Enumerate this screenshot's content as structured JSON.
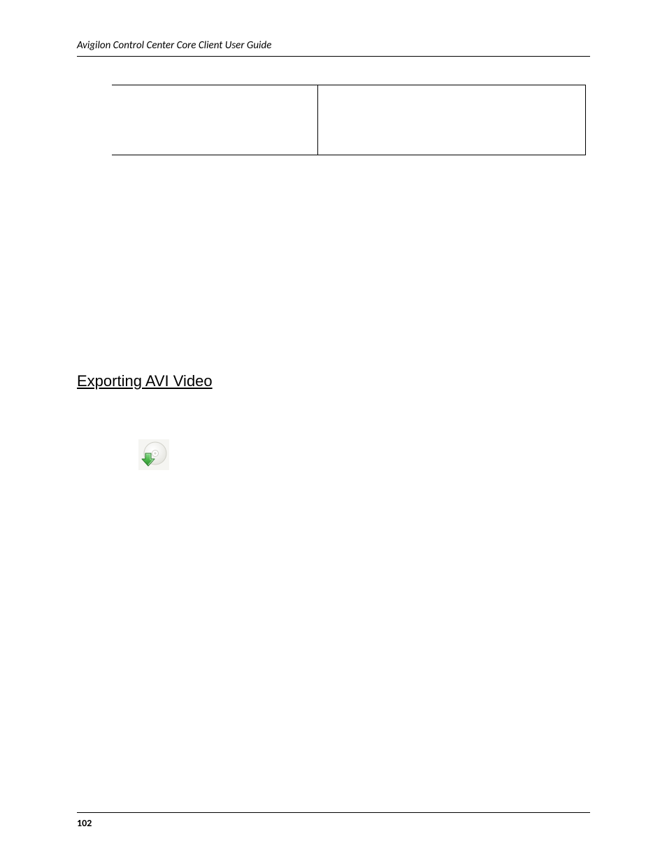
{
  "header": {
    "running_title": "Avigilon Control Center Core Client User Guide"
  },
  "table": {
    "row": {
      "col1": "",
      "col2": ""
    }
  },
  "section": {
    "heading": "Exporting AVI Video"
  },
  "icons": {
    "export": "export-icon"
  },
  "footer": {
    "page_number": "102"
  }
}
